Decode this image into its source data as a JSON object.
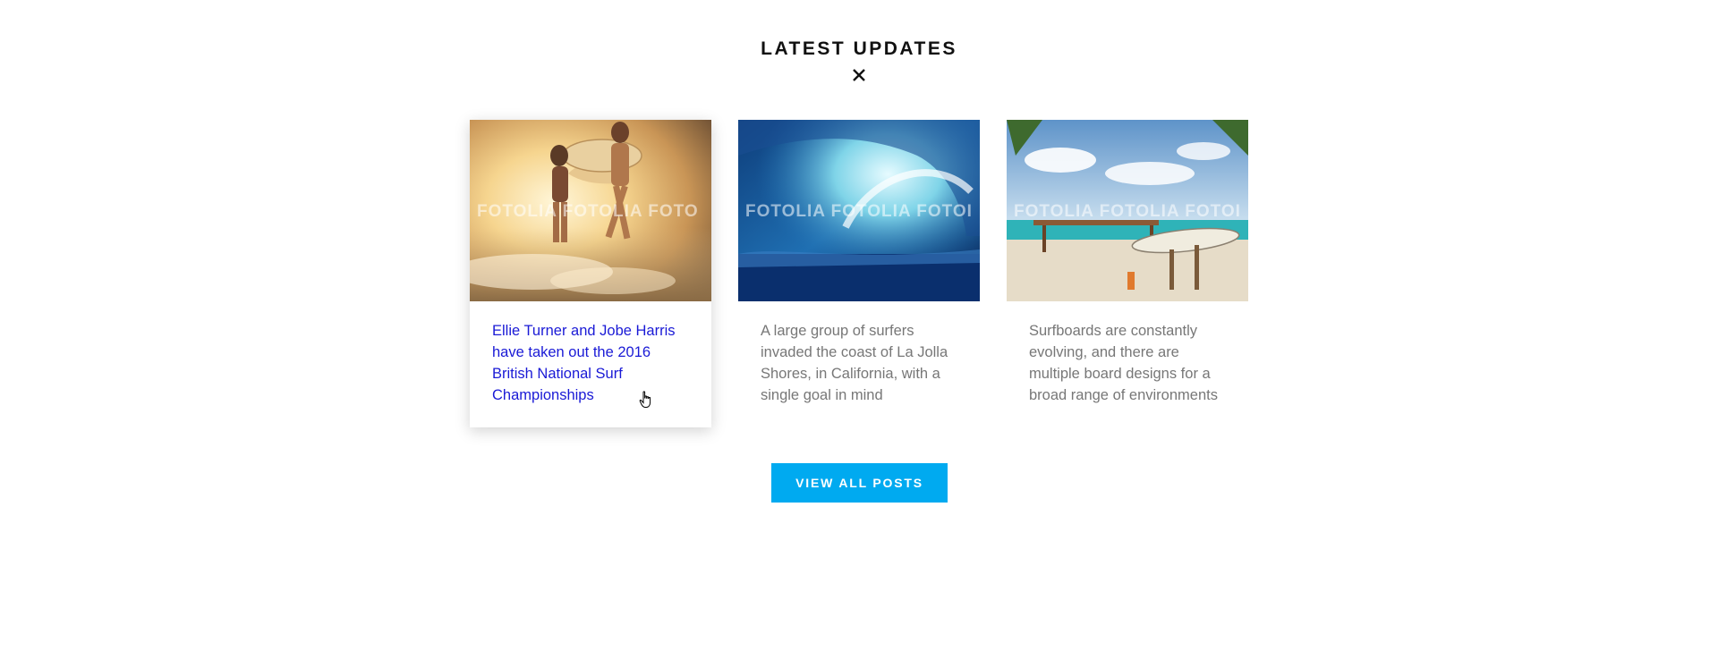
{
  "section": {
    "title": "LATEST UPDATES",
    "divider_icon": "close-x-icon"
  },
  "posts": [
    {
      "text": "Ellie Turner and Jobe Harris have taken out the 2016 British National Surf Championships",
      "image": "surfers-running-beach-image",
      "watermark": "FOTOLIA FOTOLIA FOTO",
      "state": "hovered",
      "link_color": "#1a1ad6"
    },
    {
      "text": "A large group of surfers invaded the coast of La Jolla Shores, in California, with a single goal in mind",
      "image": "ocean-wave-image",
      "watermark": "FOTOLIA FOTOLIA FOTOI"
    },
    {
      "text": "Surfboards are constantly evolving, and there are multiple board designs for a broad range of environments",
      "image": "beach-surfboard-image",
      "watermark": "FOTOLIA FOTOLIA FOTOI"
    }
  ],
  "button": {
    "label": "VIEW ALL POSTS",
    "color": "#00aaf0"
  },
  "colors": {
    "body_text": "#777777",
    "title": "#111111"
  }
}
